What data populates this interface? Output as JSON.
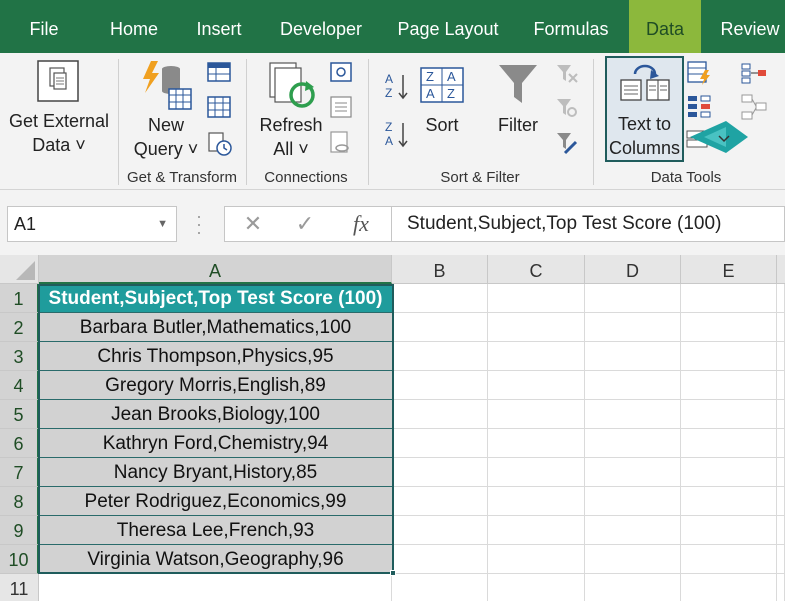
{
  "tabs": [
    {
      "label": "File"
    },
    {
      "label": "Home"
    },
    {
      "label": "Insert"
    },
    {
      "label": "Developer"
    },
    {
      "label": "Page Layout"
    },
    {
      "label": "Formulas"
    },
    {
      "label": "Data",
      "active": true
    },
    {
      "label": "Review"
    }
  ],
  "ribbon": {
    "get_external_data": {
      "line1": "Get External",
      "line2": "Data ˅"
    },
    "new_query": {
      "line1": "New",
      "line2": "Query ˅"
    },
    "refresh_all": {
      "line1": "Refresh",
      "line2": "All ˅"
    },
    "sort": "Sort",
    "filter": "Filter",
    "text_to_columns": {
      "line1": "Text to",
      "line2": "Columns"
    },
    "groups": {
      "get_transform": "Get & Transform",
      "connections": "Connections",
      "sort_filter": "Sort & Filter",
      "data_tools": "Data Tools"
    }
  },
  "formula_bar": {
    "name_box": "A1",
    "cancel": "✕",
    "enter": "✓",
    "fx": "fx",
    "formula": "Student,Subject,Top Test Score (100)"
  },
  "grid": {
    "columns": [
      "A",
      "B",
      "C",
      "D",
      "E"
    ],
    "rows": [
      "1",
      "2",
      "3",
      "4",
      "5",
      "6",
      "7",
      "8",
      "9",
      "10",
      "11"
    ],
    "column_a": [
      "Student,Subject,Top Test Score (100)",
      "Barbara Butler,Mathematics,100",
      "Chris Thompson,Physics,95",
      "Gregory Morris,English,89",
      "Jean Brooks,Biology,100",
      "Kathryn Ford,Chemistry,94",
      "Nancy Bryant,History,85",
      "Peter Rodriguez,Economics,99",
      "Theresa Lee,French,93",
      "Virginia Watson,Geography,96"
    ]
  },
  "colors": {
    "tab_bar": "#217346",
    "active_tab": "#8cb83c",
    "header_cell": "#1f9c9c",
    "data_cell": "#d2d2d2",
    "arrow": "#1fa3a3"
  }
}
